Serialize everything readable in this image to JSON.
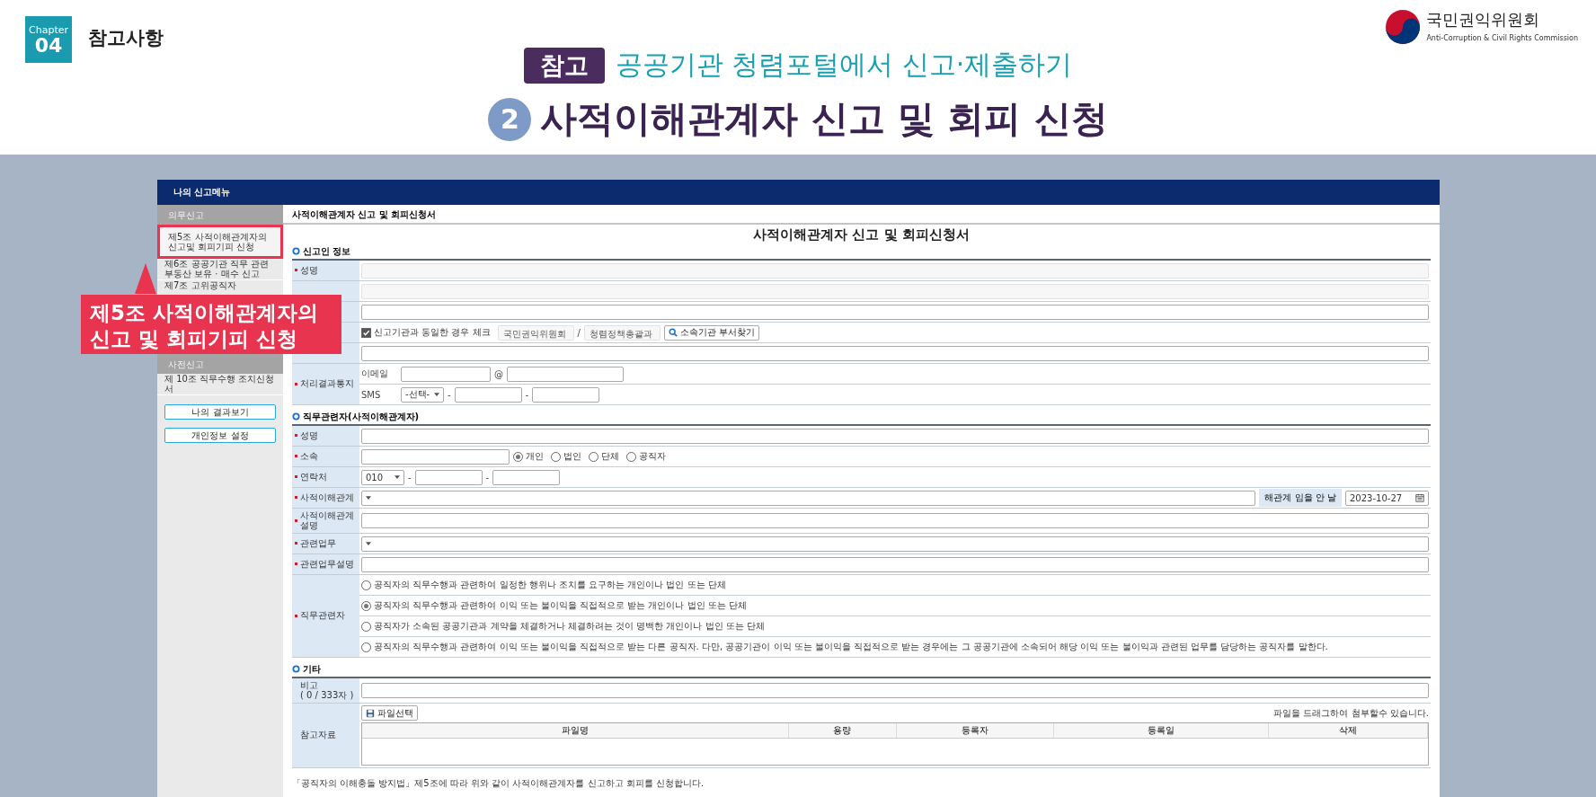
{
  "slide": {
    "chapter_label": "Chapter",
    "chapter_number": "04",
    "section": "참고사항",
    "logo_name": "국민권익위원회",
    "logo_subtitle": "Anti-Corruption & Civil Rights Commission",
    "tag": "참고",
    "subtitle": "공공기관 청렴포털에서 신고·제출하기",
    "step": "2",
    "title": "사적이해관계자 신고 및 회피 신청"
  },
  "callout": {
    "text": "제5조 사적이해관계자의\n신고 및 회피기피 신청"
  },
  "menu": {
    "title": "나의 신고메뉴",
    "groups": [
      {
        "heading": "의무신고",
        "items": [
          {
            "label": "제5조 사적이해관계자의\n신고및 회피기피 신청",
            "selected": true
          },
          {
            "label": "제6조 공공기관 직무 관련\n부동산 보유 · 매수 신고",
            "selected": false
          },
          {
            "label": "제7조 고위공직자",
            "selected": false
          }
        ]
      },
      {
        "heading": "사전신고",
        "items": [
          {
            "label": "제 10조 직무수행 조치신청서",
            "selected": false
          }
        ]
      }
    ],
    "buttons": [
      "나의 결과보기",
      "개인정보 설정"
    ]
  },
  "form": {
    "breadcrumb": "사적이해관계자 신고 및 회피신청서",
    "title": "사적이해관계자 신고 및 회피신청서",
    "sections": [
      {
        "heading": "신고인 정보",
        "rows": [
          {
            "kind": "readonly",
            "label": "성명",
            "required": true
          },
          {
            "kind": "readonly"
          },
          {
            "kind": "input"
          },
          {
            "kind": "org",
            "checkbox": {
              "label": "신고기관과 동일한 경우 체크",
              "checked": true
            },
            "org": "국민권익위원회",
            "separator": "/",
            "dept": "청렴정책총괄과",
            "button": "소속기관 부서찾기"
          },
          {
            "kind": "input"
          },
          {
            "kind": "notify",
            "label": "처리결과통지",
            "required": true,
            "email_label": "이메일",
            "at": "@",
            "sms_label": "SMS",
            "select": "-선택-",
            "dashes": [
              "-",
              "-"
            ]
          }
        ]
      },
      {
        "heading": "직무관련자(사적이해관계자)",
        "rows": [
          {
            "kind": "input",
            "label": "성명",
            "required": true
          },
          {
            "kind": "affiliation",
            "label": "소속",
            "required": true,
            "options": [
              {
                "label": "개인",
                "selected": true
              },
              {
                "label": "법인",
                "selected": false
              },
              {
                "label": "단체",
                "selected": false
              },
              {
                "label": "공직자",
                "selected": false
              }
            ]
          },
          {
            "kind": "phone",
            "label": "연락처",
            "required": true,
            "select": "010",
            "dashes": [
              "-",
              "-"
            ]
          },
          {
            "kind": "relation",
            "label": "사적이해관계",
            "required": true,
            "side_label": "해관계 임을 안 날",
            "date": "2023-10-27"
          },
          {
            "kind": "input",
            "label": "사적이해관계설명",
            "required": true
          },
          {
            "kind": "select",
            "label": "관련업무",
            "required": true
          },
          {
            "kind": "input",
            "label": "관련업무설명",
            "required": true
          },
          {
            "kind": "choices",
            "label": "직무관련자",
            "required": true,
            "options": [
              {
                "label": "공직자의 직무수행과 관련하여 일정한 행위나 조치를 요구하는 개인이나 법인 또는 단체",
                "selected": false
              },
              {
                "label": "공직자의 직무수행과 관련하여 이익 또는 불이익을 직접적으로 받는 개인이나 법인 또는 단체",
                "selected": true
              },
              {
                "label": "공직자가 소속된 공공기관과 계약을 체결하거나 체결하려는 것이 명백한 개인이나 법인 또는 단체",
                "selected": false
              },
              {
                "label": "공직자의 직무수행과 관련하여 이익 또는 불이익을 직접적으로 받는 다른 공직자. 다만, 공공기관이 이익 또는 불이익을 직접적으로 받는 경우에는 그 공공기관에 소속되어 해당 이익 또는 불이익과 관련된 업무를 담당하는 공직자를 말한다.",
                "selected": false
              }
            ]
          }
        ]
      },
      {
        "heading": "기타",
        "rows": [
          {
            "kind": "note",
            "label": "비고",
            "required": false,
            "counter": "( 0 / 333자 )"
          },
          {
            "kind": "files",
            "label": "참고자료",
            "required": false,
            "button": "파일선택",
            "hint": "파일을 드래그하여 첨부할수 있습니다.",
            "columns": [
              "파일명",
              "용량",
              "등록자",
              "등록일",
              "삭제"
            ]
          }
        ]
      }
    ],
    "footer": "「공직자의 이해충돌 방지법」제5조에 따라 위와 같이 사적이해관계자를 신고하고 회피를 신청합니다."
  }
}
